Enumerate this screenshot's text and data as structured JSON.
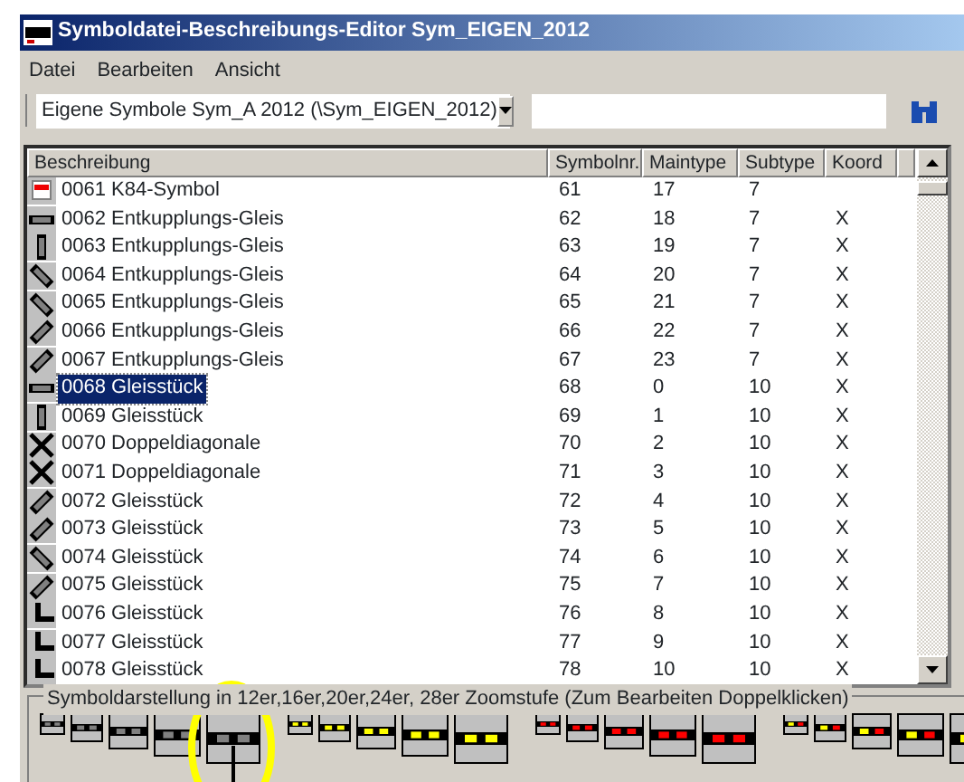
{
  "window": {
    "title": "Symboldatei-Beschreibungs-Editor Sym_EIGEN_2012"
  },
  "menu": [
    "Datei",
    "Bearbeiten",
    "Ansicht"
  ],
  "toolbar": {
    "file_select": "Eigene Symbole Sym_A 2012  (\\Sym_EIGEN_2012)"
  },
  "table": {
    "columns": [
      "Beschreibung",
      "Symbolnr.",
      "Maintype",
      "Subtype",
      "Koord"
    ],
    "rows": [
      {
        "beschreibung": "0061 K84-Symbol",
        "symbolnr": "61",
        "maintype": "17",
        "subtype": "7",
        "selected": false
      },
      {
        "beschreibung": "0062 Entkupplungs-Gleis",
        "symbolnr": "62",
        "maintype": "18",
        "subtype": "7",
        "koord": "X",
        "selected": false
      },
      {
        "beschreibung": "0063 Entkupplungs-Gleis",
        "symbolnr": "63",
        "maintype": "19",
        "subtype": "7",
        "koord": "X",
        "selected": false
      },
      {
        "beschreibung": "0064 Entkupplungs-Gleis",
        "symbolnr": "64",
        "maintype": "20",
        "subtype": "7",
        "koord": "X",
        "selected": false
      },
      {
        "beschreibung": "0065 Entkupplungs-Gleis",
        "symbolnr": "65",
        "maintype": "21",
        "subtype": "7",
        "koord": "X",
        "selected": false
      },
      {
        "beschreibung": "0066 Entkupplungs-Gleis",
        "symbolnr": "66",
        "maintype": "22",
        "subtype": "7",
        "koord": "X",
        "selected": false
      },
      {
        "beschreibung": "0067 Entkupplungs-Gleis",
        "symbolnr": "67",
        "maintype": "23",
        "subtype": "7",
        "koord": "X",
        "selected": false
      },
      {
        "beschreibung": "0068 Gleisstück",
        "symbolnr": "68",
        "maintype": "0",
        "subtype": "10",
        "koord": "X",
        "selected": true
      },
      {
        "beschreibung": "0069 Gleisstück",
        "symbolnr": "69",
        "maintype": "1",
        "subtype": "10",
        "koord": "X",
        "selected": false
      },
      {
        "beschreibung": "0070 Doppeldiagonale",
        "symbolnr": "70",
        "maintype": "2",
        "subtype": "10",
        "koord": "X",
        "selected": false
      },
      {
        "beschreibung": "0071 Doppeldiagonale",
        "symbolnr": "71",
        "maintype": "3",
        "subtype": "10",
        "koord": "X",
        "selected": false
      },
      {
        "beschreibung": "0072 Gleisstück",
        "symbolnr": "72",
        "maintype": "4",
        "subtype": "10",
        "koord": "X",
        "selected": false
      },
      {
        "beschreibung": "0073 Gleisstück",
        "symbolnr": "73",
        "maintype": "5",
        "subtype": "10",
        "koord": "X",
        "selected": false
      },
      {
        "beschreibung": "0074 Gleisstück",
        "symbolnr": "74",
        "maintype": "6",
        "subtype": "10",
        "koord": "X",
        "selected": false
      },
      {
        "beschreibung": "0075 Gleisstück",
        "symbolnr": "75",
        "maintype": "7",
        "subtype": "10",
        "koord": "X",
        "selected": false
      },
      {
        "beschreibung": "0076 Gleisstück",
        "symbolnr": "76",
        "maintype": "8",
        "subtype": "10",
        "koord": "X",
        "selected": false
      },
      {
        "beschreibung": "0077 Gleisstück",
        "symbolnr": "77",
        "maintype": "9",
        "subtype": "10",
        "koord": "X",
        "selected": false
      },
      {
        "beschreibung": "0078 Gleisstück",
        "symbolnr": "78",
        "maintype": "10",
        "subtype": "10",
        "koord": "X",
        "selected": false
      }
    ]
  },
  "preview": {
    "label": "Symboldarstellung in 12er,16er,20er,24er, 28er Zoomstufe  (Zum Bearbeiten Doppelklicken)",
    "groups": [
      {
        "kind": "grey"
      },
      {
        "kind": "yellow"
      },
      {
        "kind": "red"
      },
      {
        "kind": "mixed"
      }
    ]
  }
}
